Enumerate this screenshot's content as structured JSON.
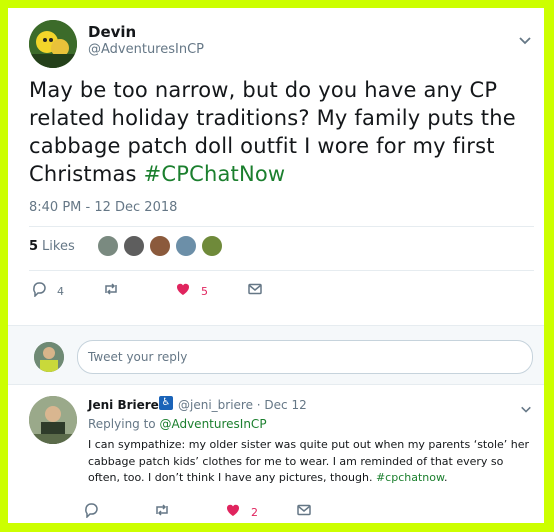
{
  "main_tweet": {
    "author_name": "Devin",
    "author_handle": "@AdventuresInCP",
    "text": "May be too narrow, but do you have any CP related holiday traditions? My family puts the cabbage patch doll outfit I wore for my first Christmas ",
    "hashtag": "#CPChatNow",
    "timestamp": "8:40 PM - 12 Dec 2018",
    "likes_count": "5",
    "likes_label": "Likes",
    "reply_count": "4",
    "retweet_count": "",
    "like_count": "5"
  },
  "reply_box": {
    "placeholder": "Tweet your reply"
  },
  "reply_tweet": {
    "author_name": "Jeni Briere",
    "badge": "♿",
    "meta": "@jeni_briere · Dec 12",
    "replying_prefix": "Replying to ",
    "replying_to": "@AdventuresInCP",
    "text": "I can sympathize: my older sister was quite put out when my parents ‘stole’ her cabbage patch kids’ clothes for me to wear. I am reminded of that every so often, too. I don’t think I have any pictures, though. ",
    "hashtag": "#cpchatnow",
    "text_end": ".",
    "reply_count": "",
    "retweet_count": "",
    "like_count": "2"
  },
  "colors": {
    "border": "#ccff00",
    "hashtag": "#1b7f2e",
    "like_red": "#e0245e",
    "muted": "#657786"
  },
  "icons": [
    "chevron-down-icon",
    "reply-icon",
    "retweet-icon",
    "heart-icon",
    "dm-icon",
    "accessibility-icon"
  ]
}
